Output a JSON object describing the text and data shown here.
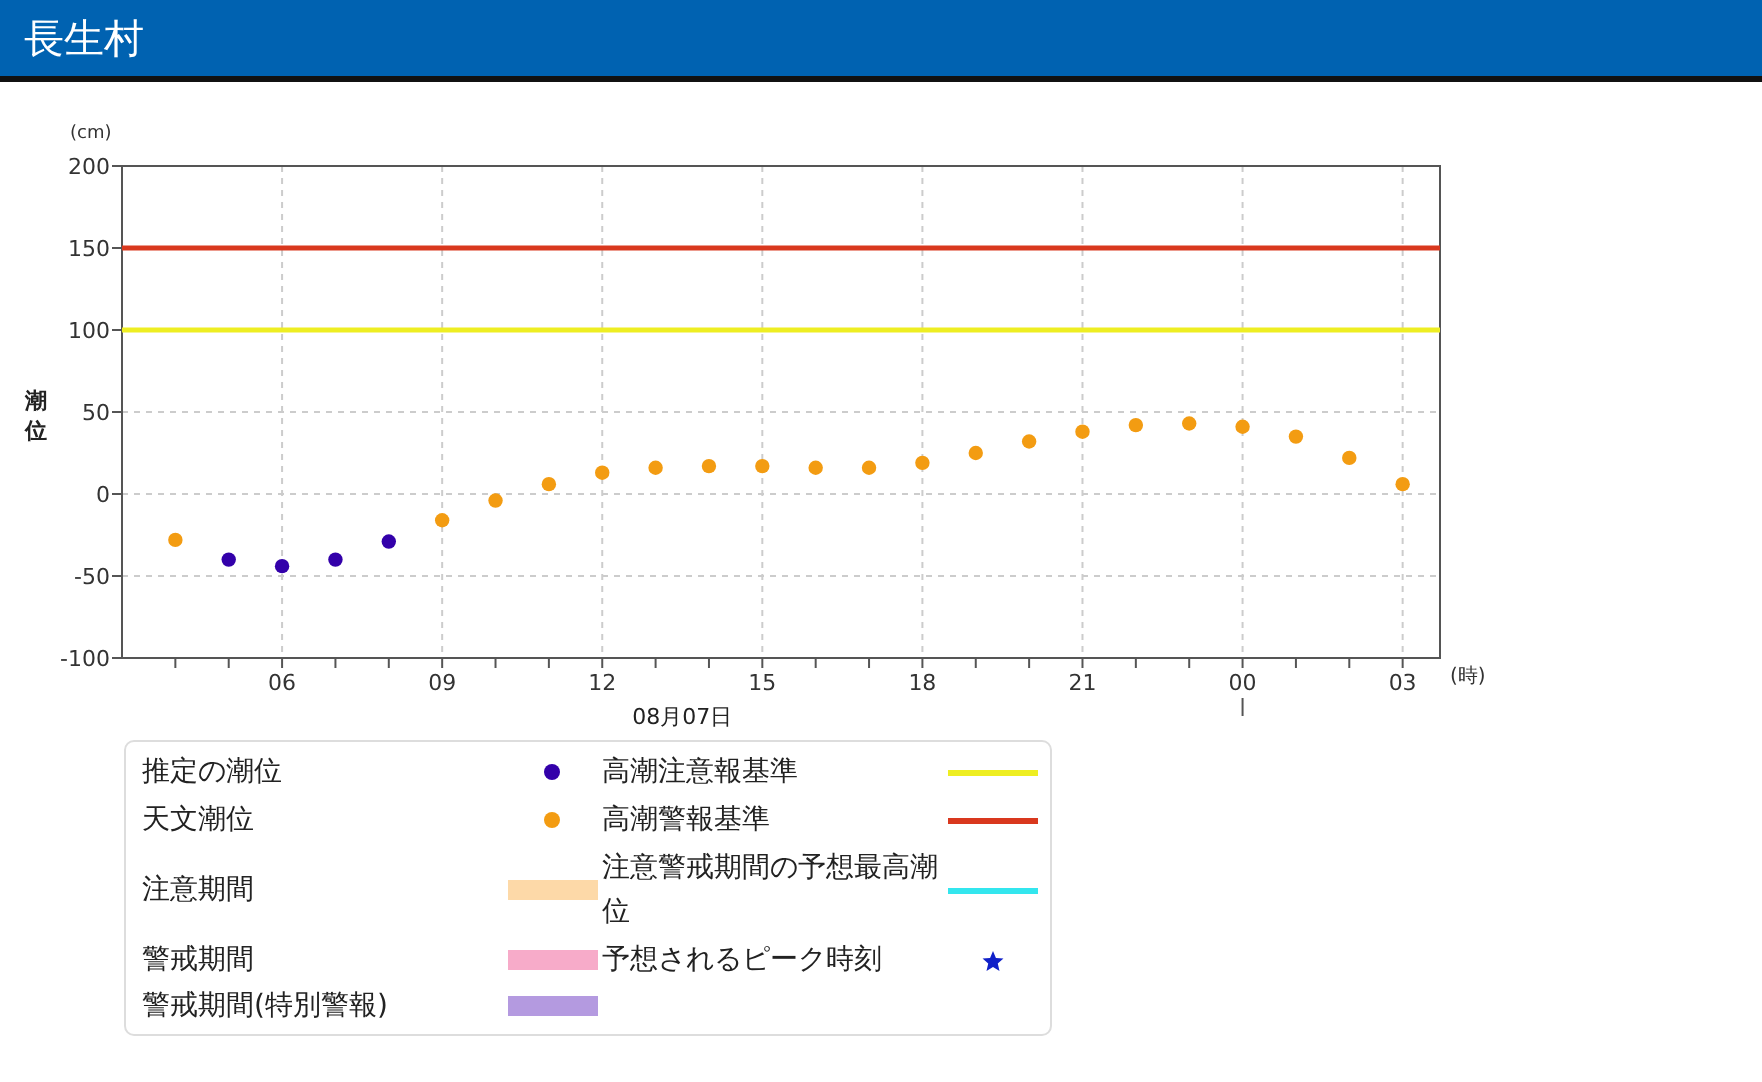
{
  "header": {
    "title": "長生村"
  },
  "chart": {
    "unit": "(cm)",
    "x_unit": "(時)",
    "date_label": "08月07日",
    "chart_data": {
      "type": "scatter",
      "ylabel": "潮位",
      "ylim": [
        -100,
        200
      ],
      "yticks": [
        {
          "value": -100,
          "label": "-100"
        },
        {
          "value": -50,
          "label": "-50"
        },
        {
          "value": 0,
          "label": "0"
        },
        {
          "value": 50,
          "label": "50"
        },
        {
          "value": 100,
          "label": "100"
        },
        {
          "value": 150,
          "label": "150"
        },
        {
          "value": 200,
          "label": "200"
        }
      ],
      "categories": [
        null,
        null,
        "06",
        null,
        null,
        "09",
        null,
        null,
        "12",
        null,
        null,
        "15",
        null,
        null,
        "18",
        null,
        null,
        "21",
        null,
        null,
        "00",
        null,
        null,
        "03"
      ],
      "series": [
        {
          "color": "#3300aa",
          "values": [
            null,
            -40,
            -44,
            -40,
            -29,
            null,
            null,
            null,
            null,
            null,
            null,
            null,
            null,
            null,
            null,
            null,
            null,
            null,
            null,
            null,
            null,
            null,
            null,
            null
          ]
        },
        {
          "color": "#f39c12",
          "values": [
            -28,
            null,
            null,
            null,
            null,
            -16,
            -4,
            6,
            13,
            16,
            17,
            17,
            16,
            16,
            19,
            25,
            32,
            38,
            42,
            43,
            41,
            35,
            22,
            6
          ]
        }
      ],
      "grid": true,
      "ref_lines": [
        {
          "axis": "y",
          "value": 150,
          "color": "#d9381e"
        },
        {
          "axis": "y",
          "value": 100,
          "color": "#eeee22"
        }
      ]
    }
  },
  "legend": {
    "rows": [
      {
        "left": {
          "label": "推定の潮位",
          "kind": "dot",
          "color": "#3300aa"
        },
        "right": {
          "label": "高潮注意報基準",
          "kind": "line",
          "color": "#eeee22"
        }
      },
      {
        "left": {
          "label": "天文潮位",
          "kind": "dot",
          "color": "#f39c12"
        },
        "right": {
          "label": "高潮警報基準",
          "kind": "line",
          "color": "#d9381e"
        }
      },
      {
        "left": {
          "label": "注意期間",
          "kind": "band",
          "color": "#fdd9a8"
        },
        "right": {
          "label": "注意警戒期間の予想最高潮位",
          "kind": "line",
          "color": "#33e6ee"
        }
      },
      {
        "left": {
          "label": "警戒期間",
          "kind": "band",
          "color": "#f7abc9"
        },
        "right": {
          "label": "予想されるピーク時刻",
          "kind": "star",
          "color": "#1020c8"
        }
      },
      {
        "left": {
          "label": "警戒期間(特別警報)",
          "kind": "band",
          "color": "#b49ae0"
        }
      }
    ]
  }
}
